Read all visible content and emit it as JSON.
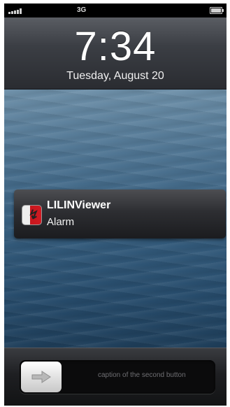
{
  "status_bar": {
    "carrier": "3G",
    "signal_icon": "signal-bars-icon",
    "battery_icon": "battery-full-icon"
  },
  "lock_screen": {
    "time": "7:34",
    "date": "Tuesday, August 20"
  },
  "notification": {
    "app_icon": "lilin-app-icon",
    "app_name": "LILINViewer",
    "message": "Alarm"
  },
  "slider": {
    "knob_icon": "arrow-right-icon",
    "caption": "caption of the second button"
  },
  "colors": {
    "status_bar_bg": "#000000",
    "notification_accent": "#c8161d"
  }
}
